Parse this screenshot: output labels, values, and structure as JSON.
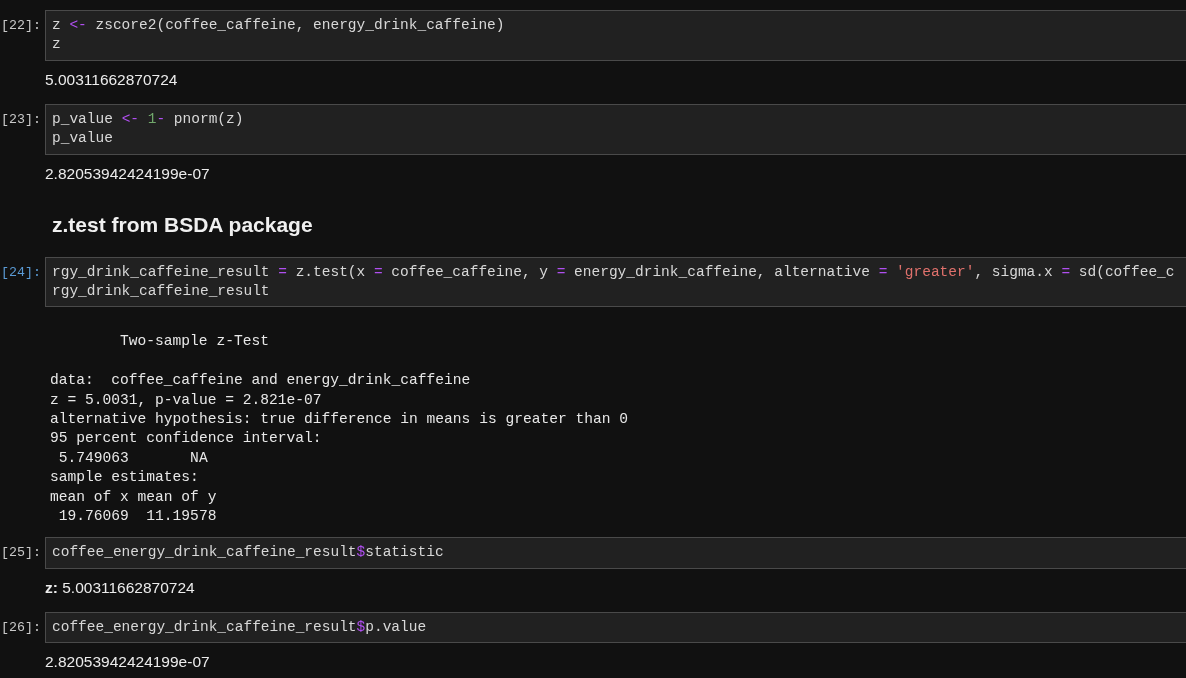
{
  "cells": [
    {
      "kind": "code",
      "prompt": "[22]:",
      "selected": false,
      "lines": [
        [
          {
            "kind": "plain",
            "text": "z "
          },
          {
            "kind": "operator",
            "text": "<-"
          },
          {
            "kind": "plain",
            "text": " zscore2(coffee_caffeine, energy_drink_caffeine)"
          }
        ],
        [
          {
            "kind": "plain",
            "text": "z"
          }
        ]
      ],
      "output": {
        "kind": "text",
        "text": "5.00311662870724"
      }
    },
    {
      "kind": "code",
      "prompt": "[23]:",
      "selected": false,
      "lines": [
        [
          {
            "kind": "plain",
            "text": "p_value "
          },
          {
            "kind": "operator",
            "text": "<-"
          },
          {
            "kind": "number",
            "text": " 1"
          },
          {
            "kind": "operator",
            "text": "-"
          },
          {
            "kind": "plain",
            "text": " pnorm(z)"
          }
        ],
        [
          {
            "kind": "plain",
            "text": "p_value"
          }
        ]
      ],
      "output": {
        "kind": "text",
        "text": "2.82053942424199e-07"
      }
    },
    {
      "kind": "markdown",
      "selected": false,
      "heading": "z.test from BSDA package"
    },
    {
      "kind": "code",
      "prompt": "[24]:",
      "selected": true,
      "lines": [
        [
          {
            "kind": "plain",
            "text": "rgy_drink_caffeine_result "
          },
          {
            "kind": "operator",
            "text": "="
          },
          {
            "kind": "plain",
            "text": " z.test(x "
          },
          {
            "kind": "operator",
            "text": "="
          },
          {
            "kind": "plain",
            "text": " coffee_caffeine, y "
          },
          {
            "kind": "operator",
            "text": "="
          },
          {
            "kind": "plain",
            "text": " energy_drink_caffeine, alternative "
          },
          {
            "kind": "operator",
            "text": "="
          },
          {
            "kind": "string",
            "text": " 'greater'"
          },
          {
            "kind": "plain",
            "text": ", sigma.x "
          },
          {
            "kind": "operator",
            "text": "="
          },
          {
            "kind": "plain",
            "text": " sd(coffee_c"
          }
        ],
        [
          {
            "kind": "plain",
            "text": "rgy_drink_caffeine_result"
          }
        ]
      ],
      "output": {
        "kind": "pre",
        "title": "Two-sample z-Test",
        "lines": [
          "data:  coffee_caffeine and energy_drink_caffeine",
          "z = 5.0031, p-value = 2.821e-07",
          "alternative hypothesis: true difference in means is greater than 0",
          "95 percent confidence interval:",
          " 5.749063       NA",
          "sample estimates:",
          "mean of x mean of y",
          " 19.76069  11.19578"
        ]
      }
    },
    {
      "kind": "code",
      "prompt": "[25]:",
      "selected": false,
      "lines": [
        [
          {
            "kind": "plain",
            "text": "coffee_energy_drink_caffeine_result"
          },
          {
            "kind": "operator",
            "text": "$"
          },
          {
            "kind": "plain",
            "text": "statistic"
          }
        ]
      ],
      "output": {
        "kind": "text",
        "text": "**z:** 5.00311662870724"
      }
    },
    {
      "kind": "code",
      "prompt": "[26]:",
      "selected": false,
      "lines": [
        [
          {
            "kind": "plain",
            "text": "coffee_energy_drink_caffeine_result"
          },
          {
            "kind": "operator",
            "text": "$"
          },
          {
            "kind": "plain",
            "text": "p.value"
          }
        ]
      ],
      "output": {
        "kind": "text",
        "text": "2.82053942424199e-07"
      }
    }
  ]
}
